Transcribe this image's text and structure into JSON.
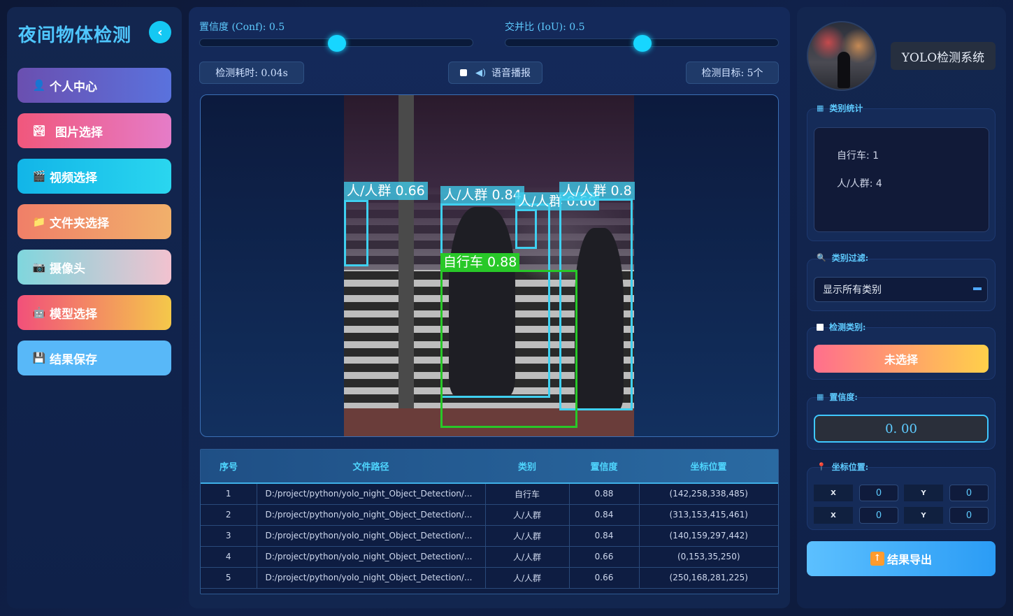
{
  "sidebar": {
    "title": "夜间物体检测",
    "items": [
      {
        "label": "个人中心",
        "icon": "user-icon",
        "glyph": "👤"
      },
      {
        "label": "图片选择",
        "icon": "image-icon",
        "glyph": "🏞"
      },
      {
        "label": "视频选择",
        "icon": "video-icon",
        "glyph": "🎬"
      },
      {
        "label": "文件夹选择",
        "icon": "folder-icon",
        "glyph": "📁"
      },
      {
        "label": "摄像头",
        "icon": "camera-icon",
        "glyph": "📷"
      },
      {
        "label": "模型选择",
        "icon": "robot-icon",
        "glyph": "🤖"
      },
      {
        "label": "结果保存",
        "icon": "save-icon",
        "glyph": "💾"
      }
    ]
  },
  "controls": {
    "conf_label": "置信度 (Conf): 0.5",
    "conf_value": 0.5,
    "iou_label": "交并比 (IoU): 0.5",
    "iou_value": 0.5,
    "time_label": "检测耗时: 0.04s",
    "voice_label": "语音播报",
    "target_label": "检测目标: 5个"
  },
  "detections_overlay": [
    {
      "label": "人/人群 0.66",
      "color": "cyan"
    },
    {
      "label": "人/人群 0.84",
      "color": "cyan"
    },
    {
      "label": "人/人群 0.66",
      "color": "cyan"
    },
    {
      "label": "人/人群 0.8",
      "color": "cyan"
    },
    {
      "label": "自行车 0.88",
      "color": "green"
    }
  ],
  "table": {
    "headers": [
      "序号",
      "文件路径",
      "类别",
      "置信度",
      "坐标位置"
    ],
    "rows": [
      [
        "1",
        "D:/project/python/yolo_night_Object_Detection/...",
        "自行车",
        "0.88",
        "(142,258,338,485)"
      ],
      [
        "2",
        "D:/project/python/yolo_night_Object_Detection/...",
        "人/人群",
        "0.84",
        "(313,153,415,461)"
      ],
      [
        "3",
        "D:/project/python/yolo_night_Object_Detection/...",
        "人/人群",
        "0.84",
        "(140,159,297,442)"
      ],
      [
        "4",
        "D:/project/python/yolo_night_Object_Detection/...",
        "人/人群",
        "0.66",
        "(0,153,35,250)"
      ],
      [
        "5",
        "D:/project/python/yolo_night_Object_Detection/...",
        "人/人群",
        "0.66",
        "(250,168,281,225)"
      ]
    ]
  },
  "right": {
    "system_title": "YOLO检测系统",
    "stats_title": "类别统计",
    "stats": [
      "自行车: 1",
      "人/人群: 4"
    ],
    "filter_title": "类别过滤:",
    "filter_value": "显示所有类别",
    "detect_title": "检测类别:",
    "detect_button": "未选择",
    "conf_title": "置信度:",
    "conf_value": "0. 00",
    "coord_title": "坐标位置:",
    "coords": [
      {
        "label": "X",
        "value": "0"
      },
      {
        "label": "Y",
        "value": "0"
      },
      {
        "label": "X",
        "value": "0"
      },
      {
        "label": "Y",
        "value": "0"
      }
    ],
    "export_label": "结果导出"
  },
  "colors": {
    "accent": "#17d6ff",
    "title": "#4fc7ff",
    "box_person": "#3fd0f0",
    "box_bicycle": "#28c828"
  }
}
